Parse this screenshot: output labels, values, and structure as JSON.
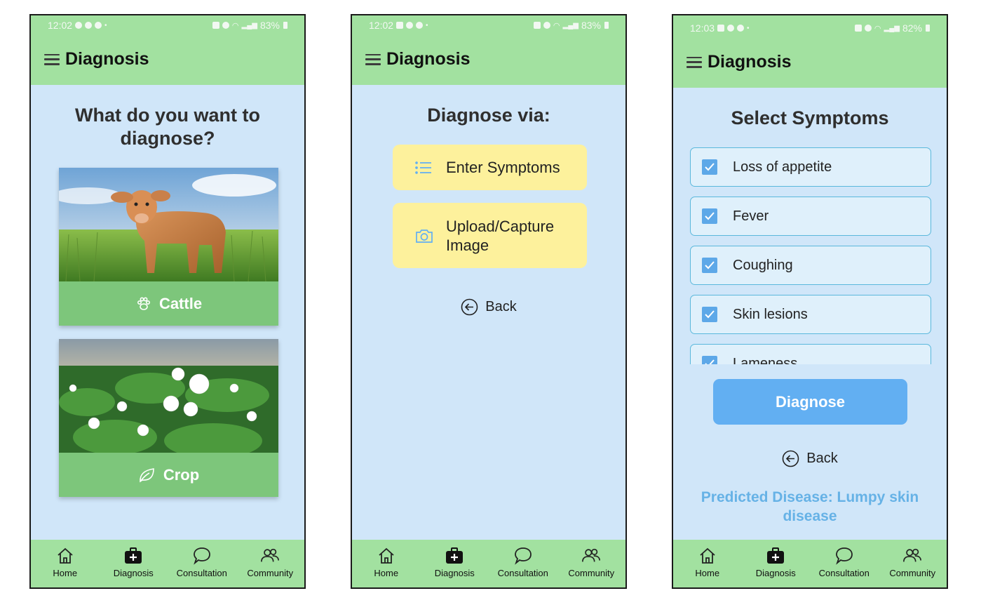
{
  "screens": [
    {
      "status": {
        "time": "12:02",
        "battery": "83%"
      },
      "header": {
        "title": "Diagnosis"
      },
      "heading": "What do you want to diagnose?",
      "cards": [
        {
          "label": "Cattle",
          "icon": "paw-icon",
          "image": "calf-in-grass-photo"
        },
        {
          "label": "Crop",
          "icon": "leaf-icon",
          "image": "cotton-field-photo"
        }
      ]
    },
    {
      "status": {
        "time": "12:02",
        "battery": "83%"
      },
      "header": {
        "title": "Diagnosis"
      },
      "heading": "Diagnose via:",
      "options": [
        {
          "label": "Enter Symptoms",
          "icon": "list-icon"
        },
        {
          "label": "Upload/Capture Image",
          "icon": "camera-icon"
        }
      ],
      "back_label": "Back"
    },
    {
      "status": {
        "time": "12:03",
        "battery": "82%"
      },
      "header": {
        "title": "Diagnosis"
      },
      "heading": "Select Symptoms",
      "symptoms": [
        {
          "label": "Loss of appetite",
          "checked": true
        },
        {
          "label": "Fever",
          "checked": true
        },
        {
          "label": "Coughing",
          "checked": true
        },
        {
          "label": "Skin lesions",
          "checked": true
        },
        {
          "label": "Lameness",
          "checked": true
        }
      ],
      "diagnose_label": "Diagnose",
      "back_label": "Back",
      "prediction": "Predicted Disease: Lumpy skin disease"
    }
  ],
  "bottom_nav": [
    {
      "label": "Home",
      "icon": "home-icon"
    },
    {
      "label": "Diagnosis",
      "icon": "medical-kit-icon"
    },
    {
      "label": "Consultation",
      "icon": "chat-bubble-icon"
    },
    {
      "label": "Community",
      "icon": "people-icon"
    }
  ],
  "colors": {
    "header_bg": "#a2e1a0",
    "screen_bg": "#d0e6f9",
    "card_button": "#7dc67b",
    "option_bg": "#fdf19c",
    "diagnose_button": "#62aff2",
    "prediction_text": "#66b2e6"
  }
}
